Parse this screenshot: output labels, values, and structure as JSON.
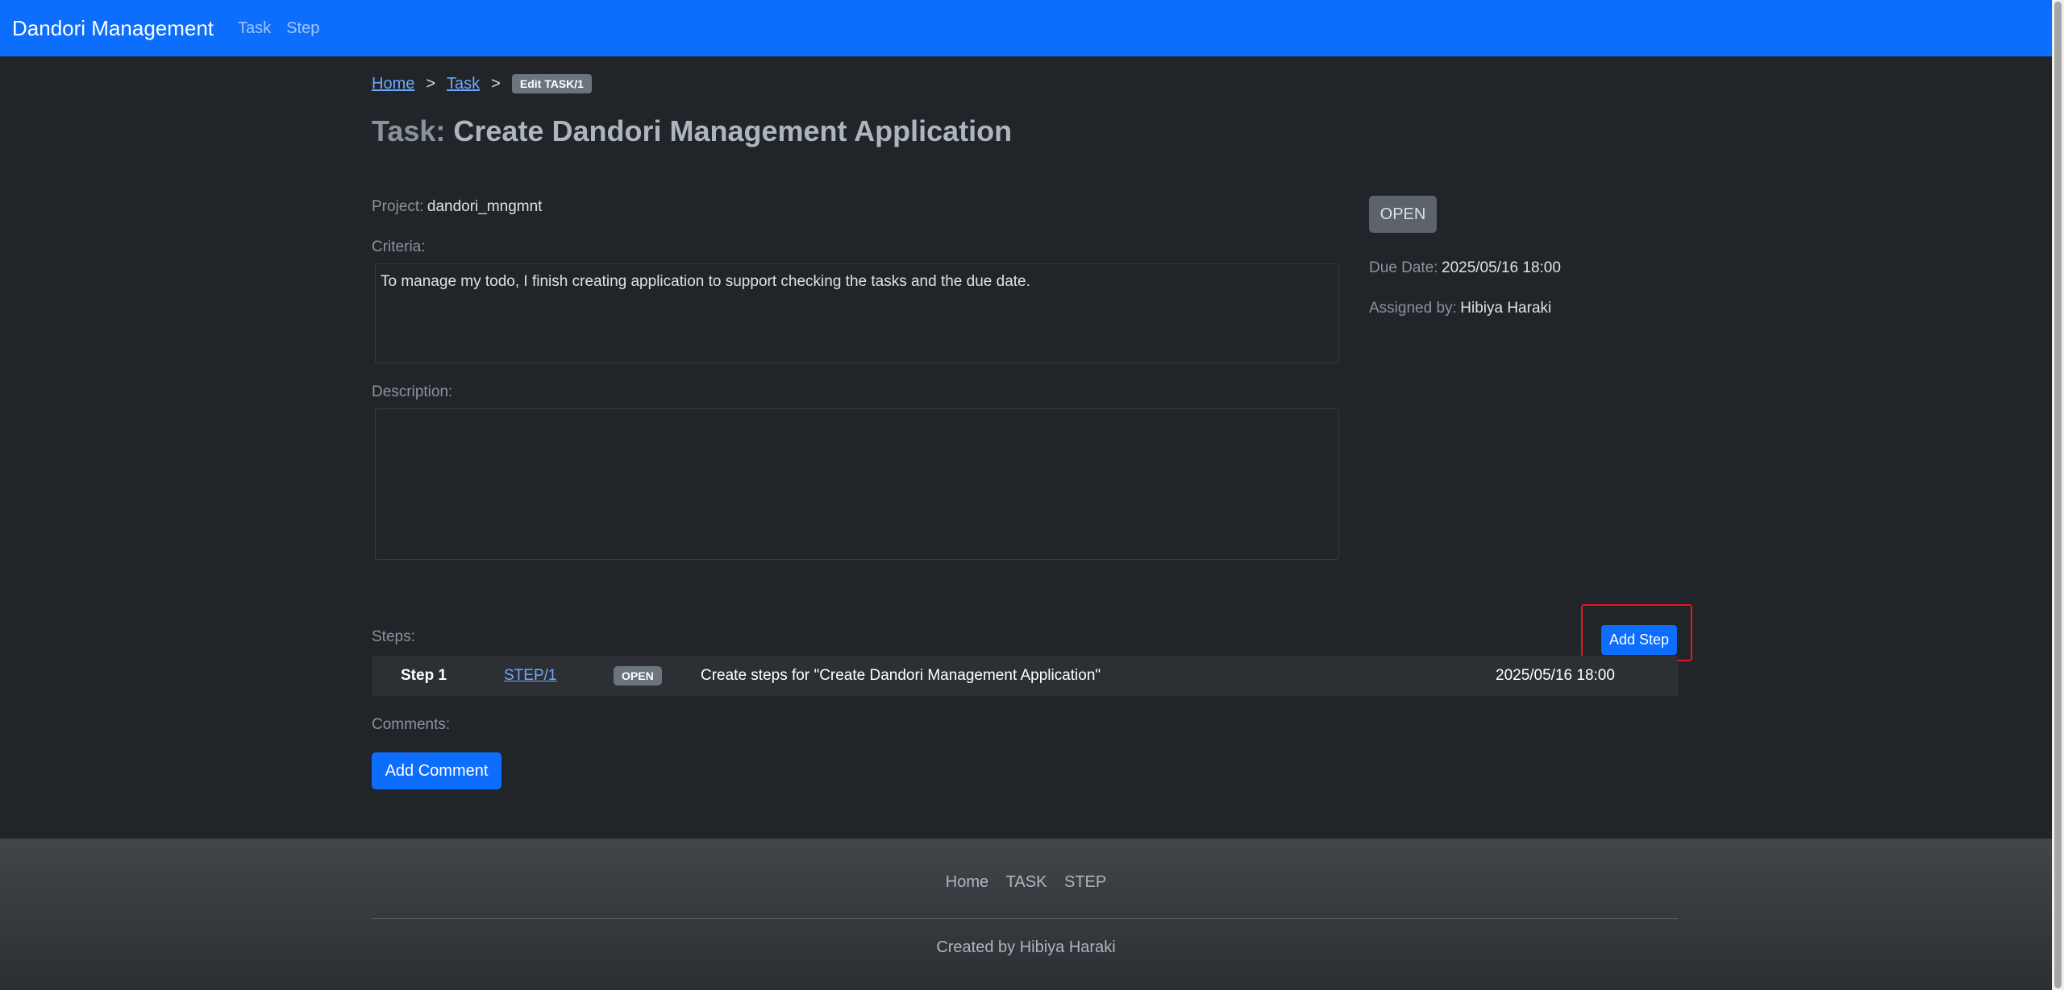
{
  "navbar": {
    "brand": "Dandori Management",
    "links": [
      "Task",
      "Step"
    ]
  },
  "breadcrumb": {
    "home": "Home",
    "task": "Task",
    "separator": ">",
    "current": "Edit TASK/1"
  },
  "page": {
    "title_prefix": "Task:",
    "title": "Create Dandori Management Application"
  },
  "task": {
    "project_label": "Project:",
    "project": "dandori_mngmnt",
    "criteria_label": "Criteria:",
    "criteria": "To manage my todo, I finish creating application to support checking the tasks and the due date.",
    "description_label": "Description:",
    "description": "",
    "status": "OPEN",
    "due_label": "Due Date:",
    "due": "2025/05/16 18:00",
    "assigned_label": "Assigned by:",
    "assigned": "Hibiya Haraki"
  },
  "steps": {
    "label": "Steps:",
    "add_button": "Add Step",
    "items": [
      {
        "number": "Step 1",
        "id": "STEP/1",
        "status": "OPEN",
        "title": "Create steps for \"Create Dandori Management Application\"",
        "due": "2025/05/16 18:00"
      }
    ]
  },
  "comments": {
    "label": "Comments:",
    "add_button": "Add Comment"
  },
  "footer": {
    "links": [
      "Home",
      "TASK",
      "STEP"
    ],
    "credit": "Created by Hibiya Haraki"
  },
  "colors": {
    "primary": "#0d6efd",
    "background": "#212529",
    "highlight": "#e0191f"
  }
}
